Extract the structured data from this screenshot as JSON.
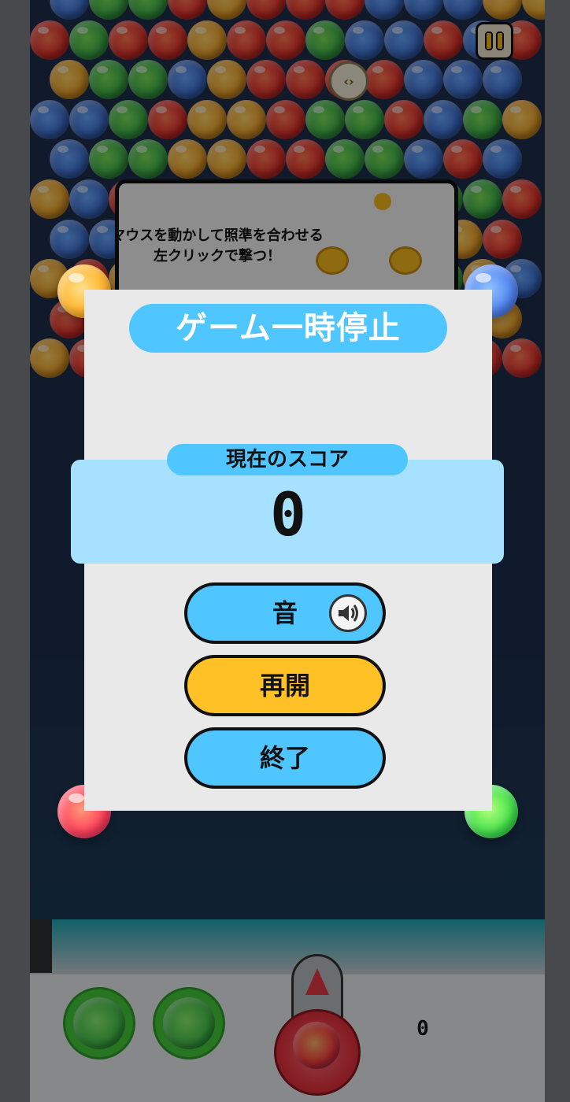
{
  "pause_menu": {
    "title": "ゲーム一時停止",
    "score_label": "現在のスコア",
    "score_value": "0",
    "sound_label": "音",
    "resume_label": "再開",
    "quit_label": "終了"
  },
  "tutorial": {
    "line1": "マウスを動かして照準を合わせる",
    "line2": "左クリックで撃つ！"
  },
  "hud": {
    "bottom_count": "0",
    "switch_icon": "‹›"
  },
  "icons": {
    "pause": "pause-icon",
    "sound": "speaker-icon",
    "switch": "swap-arrows-icon"
  },
  "colors": {
    "accent_blue": "#4fc6ff",
    "accent_yellow": "#ffc125",
    "panel_bg": "#e9e9e9",
    "score_panel": "#a6e2ff"
  },
  "bubble_grid_colors": [
    [
      "blue",
      "green",
      "green",
      "red",
      "orange",
      "red",
      "red",
      "red",
      "blue",
      "blue",
      "blue",
      "orange",
      "orange"
    ],
    [
      "red",
      "green",
      "red",
      "red",
      "orange",
      "red",
      "red",
      "green",
      "blue",
      "blue",
      "red",
      "blue",
      "red"
    ],
    [
      "orange",
      "green",
      "green",
      "blue",
      "orange",
      "red",
      "red",
      "red",
      "red",
      "blue",
      "blue",
      "blue"
    ],
    [
      "blue",
      "blue",
      "green",
      "red",
      "orange",
      "orange",
      "red",
      "green",
      "green",
      "red",
      "blue",
      "green",
      "orange"
    ],
    [
      "blue",
      "green",
      "green",
      "orange",
      "orange",
      "red",
      "red",
      "green",
      "green",
      "blue",
      "red",
      "blue"
    ],
    [
      "orange",
      "blue",
      "red",
      "red",
      "green",
      "orange",
      "red",
      "orange",
      "red",
      "red",
      "green",
      "green",
      "red"
    ],
    [
      "blue",
      "blue",
      "blue",
      "red",
      "red",
      "red",
      "red",
      "green",
      "green",
      "orange",
      "orange",
      "red"
    ],
    [
      "orange",
      "red",
      "orange",
      "red",
      "blue",
      "red",
      "blue",
      "red",
      "red",
      "green",
      "green",
      "orange",
      "blue"
    ],
    [
      "red",
      "blue",
      "green",
      "red",
      "red",
      "green",
      "orange",
      "red",
      "red",
      "green",
      "blue",
      "orange"
    ],
    [
      "orange",
      "red",
      "green",
      "red",
      "orange",
      "red",
      "red",
      "red",
      "green",
      "red",
      "blue",
      "red",
      "red"
    ]
  ]
}
